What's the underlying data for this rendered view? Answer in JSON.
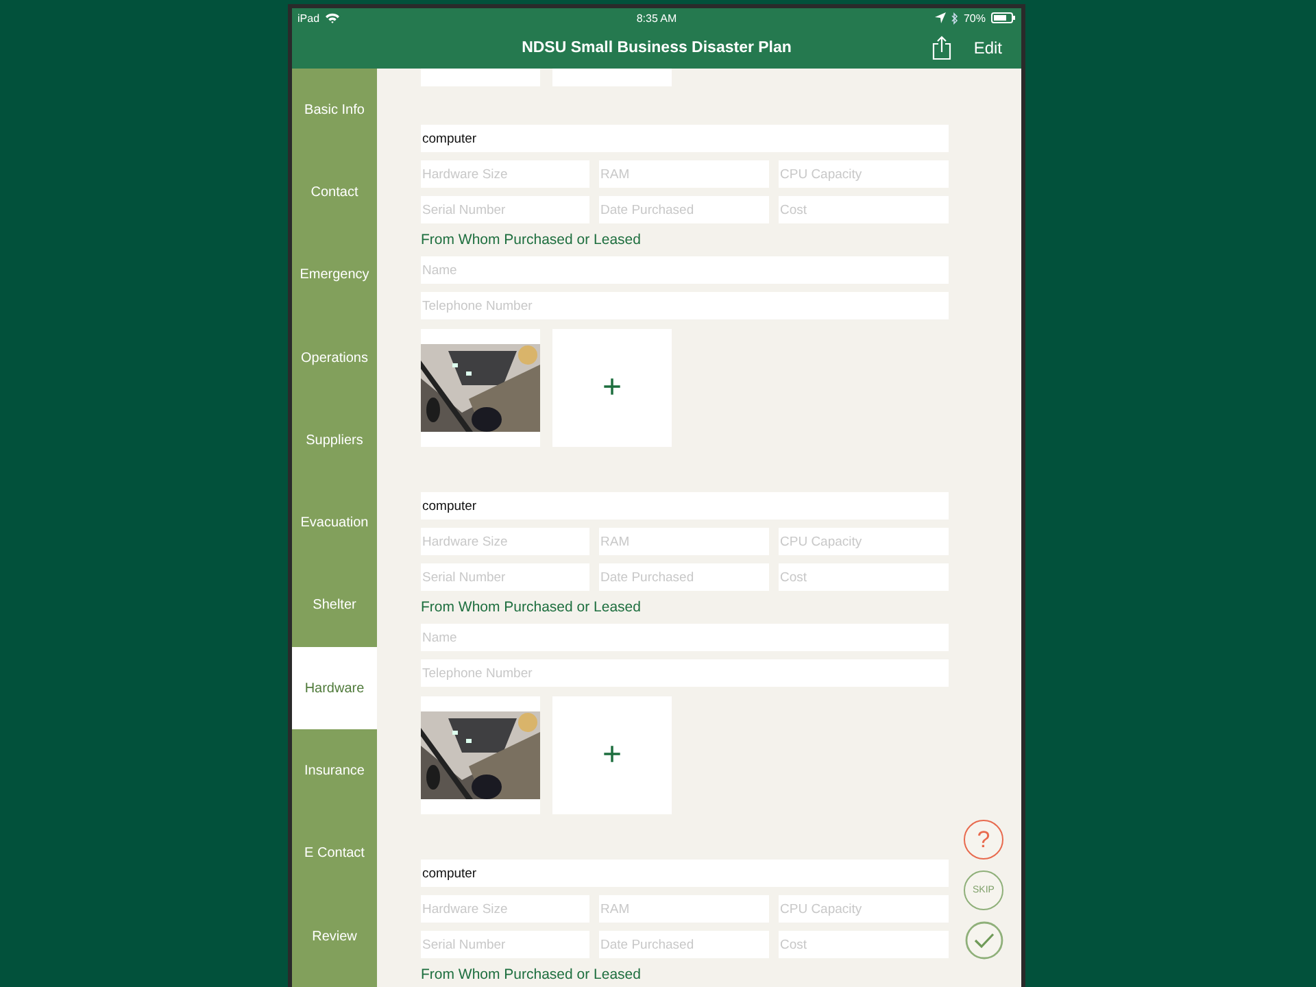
{
  "status_bar": {
    "device": "iPad",
    "time": "8:35 AM",
    "battery": "70%"
  },
  "nav_bar": {
    "title": "NDSU Small Business Disaster Plan",
    "edit": "Edit"
  },
  "sidebar": {
    "items": [
      {
        "label": "Basic Info",
        "selected": false
      },
      {
        "label": "Contact",
        "selected": false
      },
      {
        "label": "Emergency",
        "selected": false
      },
      {
        "label": "Operations",
        "selected": false
      },
      {
        "label": "Suppliers",
        "selected": false
      },
      {
        "label": "Evacuation",
        "selected": false
      },
      {
        "label": "Shelter",
        "selected": false
      },
      {
        "label": "Hardware",
        "selected": true
      },
      {
        "label": "Insurance",
        "selected": false
      },
      {
        "label": "E Contact",
        "selected": false
      },
      {
        "label": "Review",
        "selected": false
      }
    ]
  },
  "partial_fields": [
    {
      "kind": "blank"
    },
    {
      "kind": "blank"
    }
  ],
  "sections": [
    {
      "name": {
        "value": "computer"
      },
      "specs": [
        {
          "placeholder": "Hardware Size"
        },
        {
          "placeholder": "RAM"
        },
        {
          "placeholder": "CPU Capacity"
        },
        {
          "placeholder": "Serial Number"
        },
        {
          "placeholder": "Date Purchased"
        },
        {
          "placeholder": "Cost"
        }
      ],
      "vendor_label": "From Whom Purchased or Leased",
      "vendor_fields": [
        {
          "placeholder": "Name"
        },
        {
          "placeholder": "Telephone Number"
        }
      ],
      "photos": [
        {
          "kind": "picture"
        },
        {
          "kind": "add",
          "label": "+"
        }
      ]
    },
    {
      "name": {
        "value": "computer"
      },
      "specs": [
        {
          "placeholder": "Hardware Size"
        },
        {
          "placeholder": "RAM"
        },
        {
          "placeholder": "CPU Capacity"
        },
        {
          "placeholder": "Serial Number"
        },
        {
          "placeholder": "Date Purchased"
        },
        {
          "placeholder": "Cost"
        }
      ],
      "vendor_label": "From Whom Purchased or Leased",
      "vendor_fields": [
        {
          "placeholder": "Name"
        },
        {
          "placeholder": "Telephone Number"
        }
      ],
      "photos": [
        {
          "kind": "picture"
        },
        {
          "kind": "add",
          "label": "+"
        }
      ]
    },
    {
      "name": {
        "value": "computer"
      },
      "specs": [
        {
          "placeholder": "Hardware Size"
        },
        {
          "placeholder": "RAM"
        },
        {
          "placeholder": "CPU Capacity"
        },
        {
          "placeholder": "Serial Number"
        },
        {
          "placeholder": "Date Purchased"
        },
        {
          "placeholder": "Cost"
        }
      ],
      "vendor_label": "From Whom Purchased or Leased"
    }
  ],
  "float_buttons": [
    {
      "kind": "help",
      "label": "?"
    },
    {
      "kind": "skip",
      "label": "SKIP"
    },
    {
      "kind": "done"
    }
  ]
}
